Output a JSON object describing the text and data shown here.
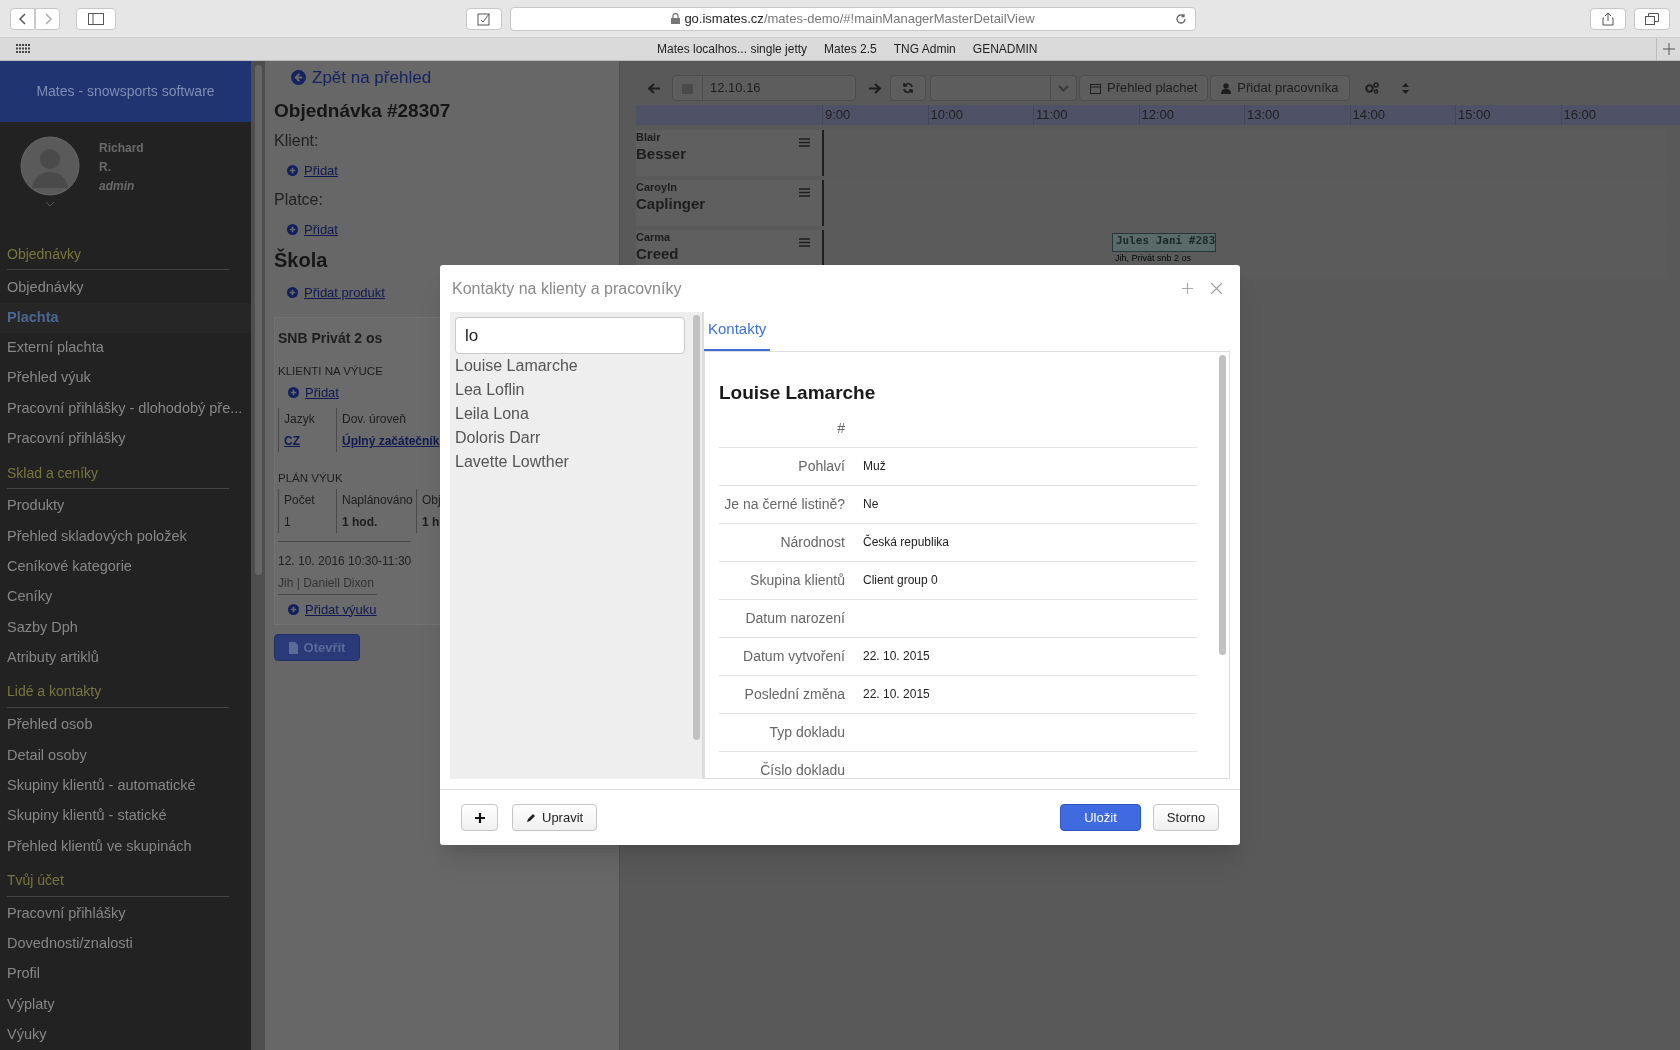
{
  "browser": {
    "url_host": "go.ismates.cz",
    "url_path": "/mates-demo/#!mainManagerMasterDetailView",
    "bookmarks": [
      "Mates localhos... single jetty",
      "Mates 2.5",
      "TNG Admin",
      "GENADMIN"
    ]
  },
  "sidebar": {
    "brand": "Mates - snowsports software",
    "user": {
      "first_name": "Richard",
      "last_name": "R.",
      "role": "admin"
    },
    "sections": [
      {
        "title": "Objednávky",
        "items": [
          {
            "label": "Objednávky",
            "selected": false
          },
          {
            "label": "Plachta",
            "selected": true
          },
          {
            "label": "Externí plachta",
            "selected": false
          },
          {
            "label": "Přehled výuk",
            "selected": false
          },
          {
            "label": "Pracovní přihlášky - dlohodobý pře...",
            "selected": false
          },
          {
            "label": "Pracovní přihlášky",
            "selected": false
          }
        ]
      },
      {
        "title": "Sklad a ceníky",
        "items": [
          {
            "label": "Produkty",
            "selected": false
          },
          {
            "label": "Přehled skladových položek",
            "selected": false
          },
          {
            "label": "Ceníkové kategorie",
            "selected": false
          },
          {
            "label": "Ceníky",
            "selected": false
          },
          {
            "label": "Sazby Dph",
            "selected": false
          },
          {
            "label": "Atributy artiklů",
            "selected": false
          }
        ]
      },
      {
        "title": "Lidé a kontakty",
        "items": [
          {
            "label": "Přehled osob",
            "selected": false
          },
          {
            "label": "Detail osoby",
            "selected": false
          },
          {
            "label": "Skupiny klientů - automatické",
            "selected": false
          },
          {
            "label": "Skupiny klientů - statické",
            "selected": false
          },
          {
            "label": "Přehled klientů ve skupinách",
            "selected": false
          }
        ]
      },
      {
        "title": "Tvůj účet",
        "items": [
          {
            "label": "Pracovní přihlášky",
            "selected": false
          },
          {
            "label": "Dovednosti/znalosti",
            "selected": false
          },
          {
            "label": "Profil",
            "selected": false
          },
          {
            "label": "Výplaty",
            "selected": false
          },
          {
            "label": "Výuky",
            "selected": false
          }
        ]
      }
    ]
  },
  "order": {
    "back_link": "Zpět na přehled",
    "title": "Objednávka #28307",
    "client_label": "Klient:",
    "client_add": "Přidat",
    "payer_label": "Platce:",
    "payer_add": "Přidat",
    "school_title": "Škola",
    "add_product": "Přidat produkt",
    "product": {
      "name": "SNB Privát 2 os",
      "clients_heading": "KLIENTI NA VÝUCE",
      "clients_add": "Přidat",
      "clients_columns": [
        "Jazyk",
        "Dov. úroveň"
      ],
      "clients_row": [
        "CZ",
        "Úplný začátečník"
      ],
      "plan_heading": "PLÁN VÝUK",
      "plan_columns": [
        "Počet",
        "Naplánováno",
        "Obj"
      ],
      "plan_row": [
        "1",
        "1 hod.",
        "1 h"
      ],
      "lesson_time": "12. 10. 2016 10:30-11:30",
      "lesson_info": "Jih | Daniell Dixon",
      "add_lesson": "Přidat výuku"
    },
    "open_button": "Otevřít"
  },
  "scheduler": {
    "date": "12.10.16",
    "overview_button": "Přehled plachet",
    "add_worker_button": "Přidat pracovníka",
    "hours": [
      "9:00",
      "10:00",
      "11:00",
      "12:00",
      "13:00",
      "14:00",
      "15:00",
      "16:00"
    ],
    "workers": [
      {
        "first_name": "Blair",
        "last_name": "Besser"
      },
      {
        "first_name": "Caroyln",
        "last_name": "Caplinger"
      },
      {
        "first_name": "Carma",
        "last_name": "Creed",
        "events": [
          {
            "title": "Jules Jani #283",
            "subtitle": "Jih, Privát snb 2 os"
          }
        ]
      }
    ]
  },
  "dialog": {
    "title": "Kontakty na klienty a pracovníky",
    "search_value": "lo",
    "results": [
      "Louise Lamarche",
      "Lea Loflin",
      "Leila Lona",
      "Doloris Darr",
      "Lavette Lowther"
    ],
    "tabs": [
      {
        "label": "Kontakty",
        "selected": true
      }
    ],
    "contact_name": "Louise Lamarche",
    "fields": [
      {
        "label": "#"
      },
      {
        "label": "Pohlaví",
        "value": "Muž"
      },
      {
        "label": "Je na černé listině?",
        "value": "Ne"
      },
      {
        "label": "Národnost",
        "value": "Česká republika"
      },
      {
        "label": "Skupina klientů",
        "value": "Client group 0"
      },
      {
        "label": "Datum narození"
      },
      {
        "label": "Datum vytvoření",
        "value": "22. 10. 2015"
      },
      {
        "label": "Poslední změna",
        "value": "22. 10. 2015"
      },
      {
        "label": "Typ dokladu"
      },
      {
        "label": "Číslo dokladu"
      }
    ],
    "edit_button": "Upravit",
    "save_button": "Uložit",
    "cancel_button": "Storno"
  }
}
